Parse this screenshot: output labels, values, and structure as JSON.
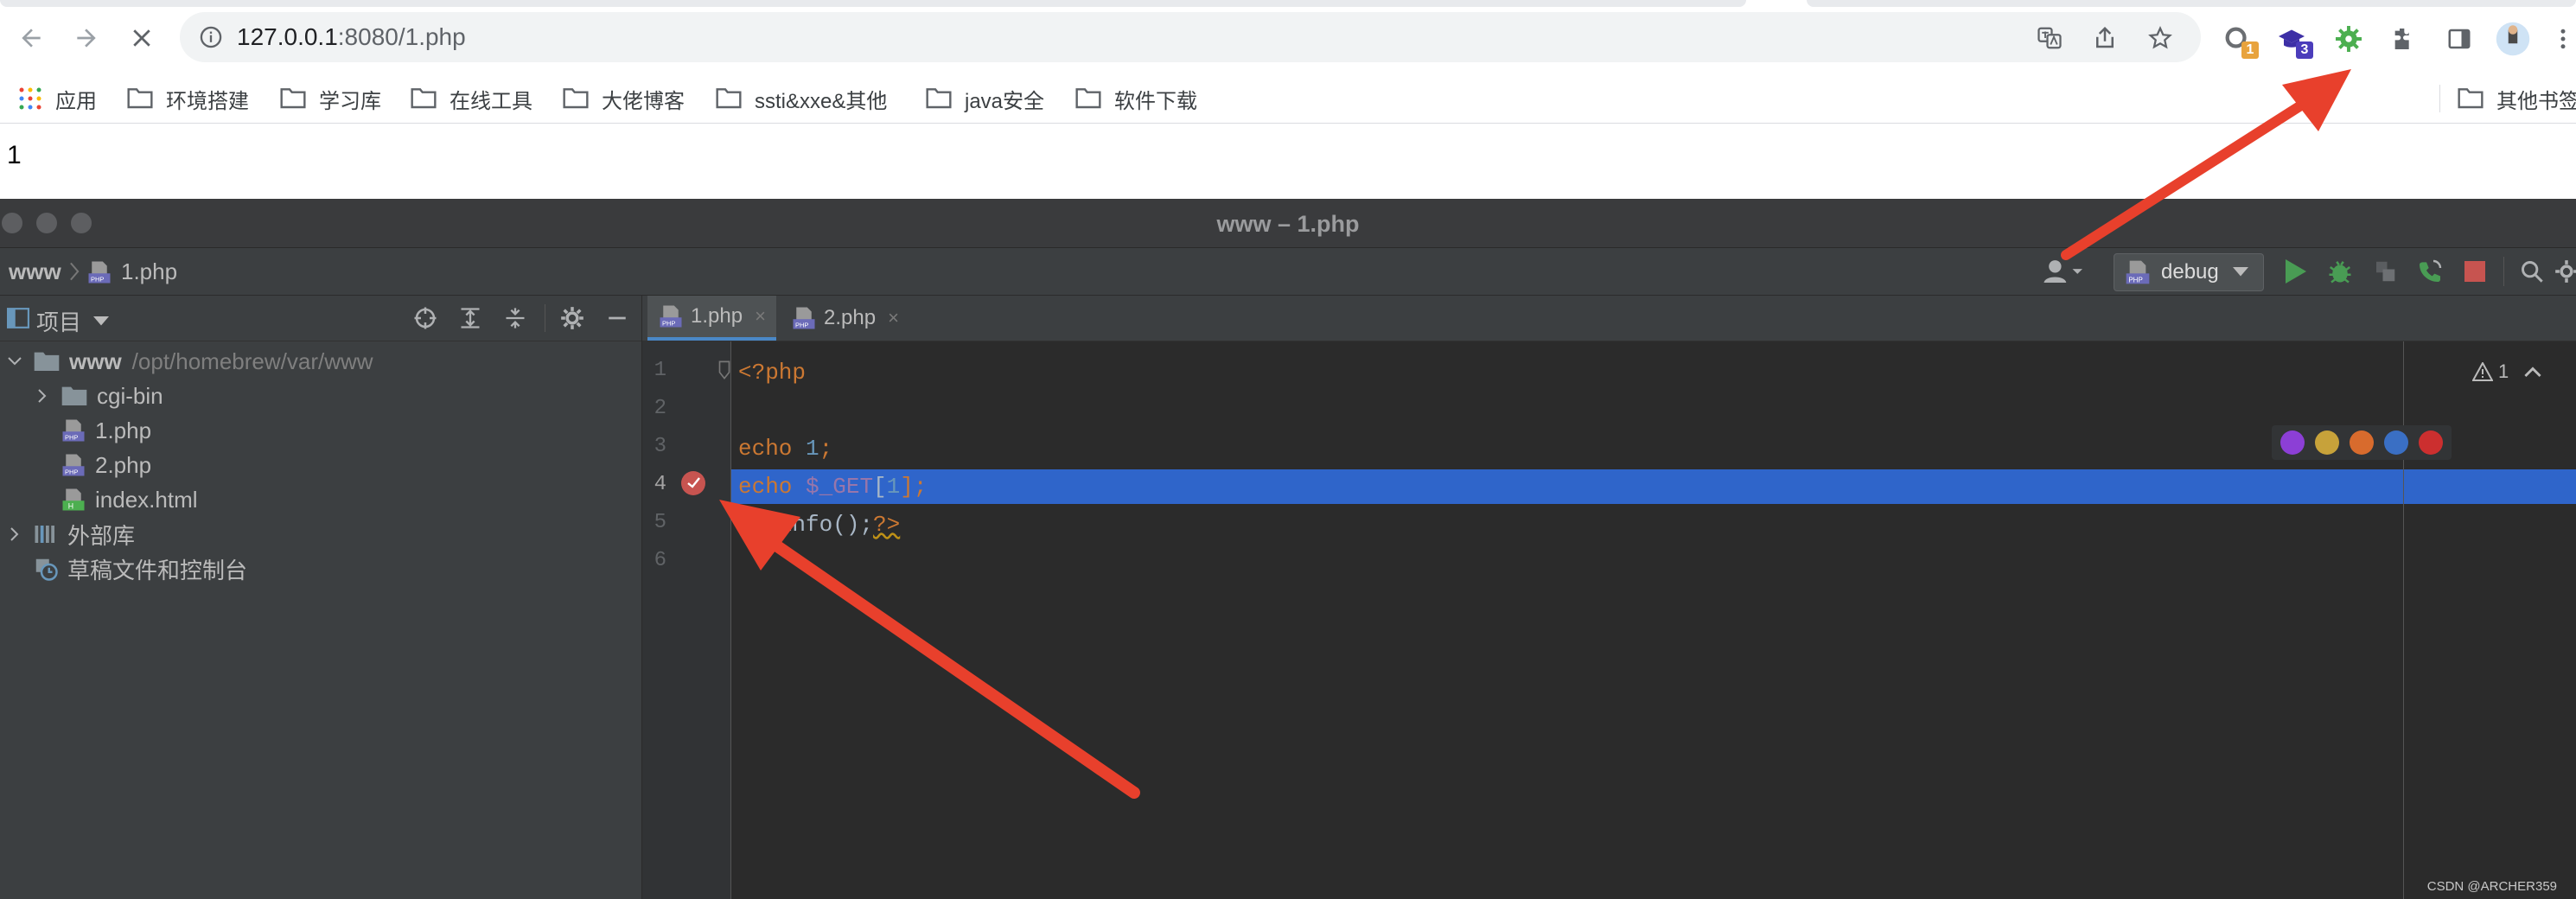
{
  "browser": {
    "url_host": "127.0.0.1",
    "url_rest": ":8080/1.php",
    "extensions": [
      {
        "name": "extension-1",
        "badge": "1",
        "badge_color": "#e8a33d"
      },
      {
        "name": "extension-2",
        "badge": "3",
        "badge_color": "#4b3dbb"
      },
      {
        "name": "xdebug-helper",
        "badge": "",
        "badge_color": "#4caf50"
      }
    ]
  },
  "bookmarks": {
    "apps_label": "应用",
    "items": [
      "环境搭建",
      "学习库",
      "在线工具",
      "大佬博客",
      "ssti&xxe&其他",
      "java安全",
      "软件下载"
    ],
    "other_label": "其他书签"
  },
  "page": {
    "output": "1"
  },
  "ide": {
    "title": "www – 1.php",
    "breadcrumb": {
      "root": "www",
      "file": "1.php"
    },
    "run_config": "debug",
    "project": {
      "header": "项目",
      "root_name": "www",
      "root_path": "/opt/homebrew/var/www",
      "items": [
        "cgi-bin",
        "1.php",
        "2.php",
        "index.html"
      ],
      "external_libs": "外部库",
      "scratches": "草稿文件和控制台"
    },
    "tabs": [
      {
        "label": "1.php",
        "active": true
      },
      {
        "label": "2.php",
        "active": false
      }
    ],
    "line_numbers": [
      "1",
      "2",
      "3",
      "4",
      "5",
      "6"
    ],
    "code": {
      "line1": "<?php",
      "line3_kw": "echo",
      "line3_num": "1",
      "line3_end": ";",
      "line4_kw": "echo",
      "line4_var": "$_GET",
      "line4_open": "[",
      "line4_num": "1",
      "line4_close": "];",
      "line5_plain": "phpinfo();",
      "line5_end": "?>"
    },
    "inspection_count": "1",
    "breakpoint_line": 4
  },
  "watermark": "CSDN @ARCHER359",
  "colors": {
    "annotation_arrow": "#e8402c",
    "selection": "#2f65ca",
    "breakpoint": "#c75450"
  }
}
